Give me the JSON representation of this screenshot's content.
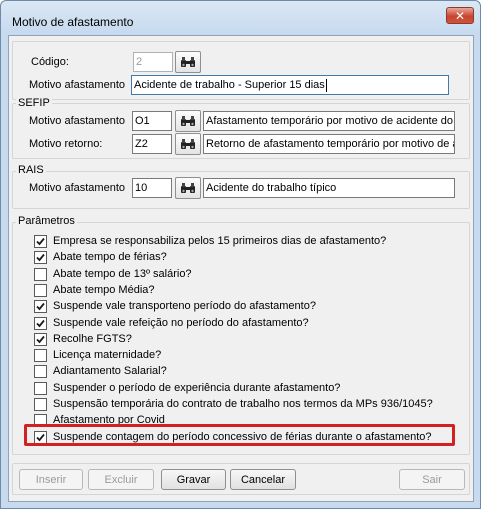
{
  "window": {
    "title": "Motivo de afastamento",
    "close_glyph": "✕"
  },
  "main": {
    "codigo_label": "Código:",
    "codigo_value": "2",
    "motivo_label": "Motivo afastamento",
    "motivo_value": "Acidente de trabalho - Superior 15 dias"
  },
  "sefip": {
    "legend": "SEFIP",
    "afastamento_label": "Motivo afastamento",
    "afastamento_code": "O1",
    "afastamento_desc": "Afastamento temporário por motivo de acidente do",
    "retorno_label": "Motivo retorno:",
    "retorno_code": "Z2",
    "retorno_desc": "Retorno de afastamento temporário por motivo de a"
  },
  "rais": {
    "legend": "RAIS",
    "afastamento_label": "Motivo afastamento",
    "afastamento_code": "10",
    "afastamento_desc": "Acidente do trabalho típico"
  },
  "parametros": {
    "legend": "Parâmetros",
    "items": [
      {
        "label": "Empresa se responsabiliza pelos 15  primeiros dias de afastamento?",
        "checked": true
      },
      {
        "label": "Abate tempo de férias?",
        "checked": true
      },
      {
        "label": "Abate tempo de 13º salário?",
        "checked": false
      },
      {
        "label": "Abate tempo Média?",
        "checked": false
      },
      {
        "label": "Suspende vale transporteno período do afastamento?",
        "checked": true
      },
      {
        "label": "Suspende vale refeição no período do afastamento?",
        "checked": true
      },
      {
        "label": "Recolhe FGTS?",
        "checked": true
      },
      {
        "label": "Licença maternidade?",
        "checked": false
      },
      {
        "label": "Adiantamento Salarial?",
        "checked": false
      },
      {
        "label": "Suspender o período de experiência durante afastamento?",
        "checked": false
      },
      {
        "label": "Suspensão temporária do contrato de trabalho nos termos da MPs 936/1045?",
        "checked": false
      },
      {
        "label": "Afastamento por Covid",
        "checked": false
      },
      {
        "label": "Suspende contagem do período concessivo de férias durante o afastamento?",
        "checked": true
      }
    ]
  },
  "buttons": {
    "inserir": "Inserir",
    "excluir": "Excluir",
    "gravar": "Gravar",
    "cancelar": "Cancelar",
    "sair": "Sair"
  },
  "colors": {
    "highlight": "#d42020",
    "titlebar": "#c6d9ee"
  }
}
